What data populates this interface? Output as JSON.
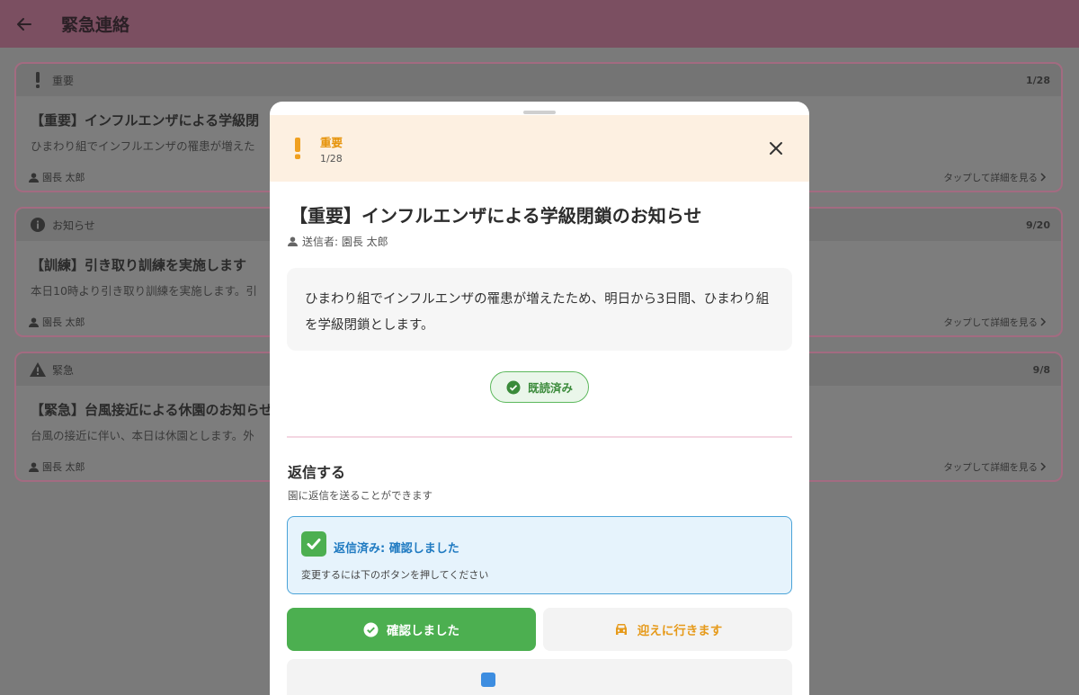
{
  "appbar": {
    "title": "緊急連絡",
    "back_icon": "arrow-left-icon"
  },
  "messages": [
    {
      "category": "重要",
      "category_icon": "exclamation-icon",
      "count": "1/28",
      "title": "【重要】インフルエンザによる学級閉",
      "body": "ひまわり組でインフルエンザの罹患が増えた",
      "sender": "園長 太郎",
      "more": "タップして詳細を見る"
    },
    {
      "category": "お知らせ",
      "category_icon": "info-icon",
      "count": "9/20",
      "title": "【訓練】引き取り訓練を実施します",
      "body": "本日10時より引き取り訓練を実施します。引",
      "sender": "園長 太郎",
      "more": "タップして詳細を見る"
    },
    {
      "category": "緊急",
      "category_icon": "warning-icon",
      "count": "9/8",
      "title": "【緊急】台風接近による休園のお知らせ",
      "body": "台風の接近に伴い、本日は休園とします。外",
      "sender": "園長 太郎",
      "more": "タップして詳細を見る"
    }
  ],
  "modal": {
    "level": "重要",
    "count": "1/28",
    "title": "【重要】インフルエンザによる学級閉鎖のお知らせ",
    "sender": "送信者: 園長 太郎",
    "body": "ひまわり組でインフルエンザの罹患が増えたため、明日から3日間、ひまわり組を学級閉鎖とします。",
    "read_status": "既読済み",
    "reply_title": "返信する",
    "reply_subtitle": "園に返信を送ることができます",
    "reply_status": "返信済み: 確認しました",
    "reply_hint": "変更するには下のボタンを押してください",
    "buttons": {
      "confirm": "確認しました",
      "pickup": "迎えに行きます"
    }
  },
  "colors": {
    "accent": "#7b4f61",
    "important": "#e6930a",
    "success": "#4caf50",
    "info_blue": "#1f7ac1"
  }
}
